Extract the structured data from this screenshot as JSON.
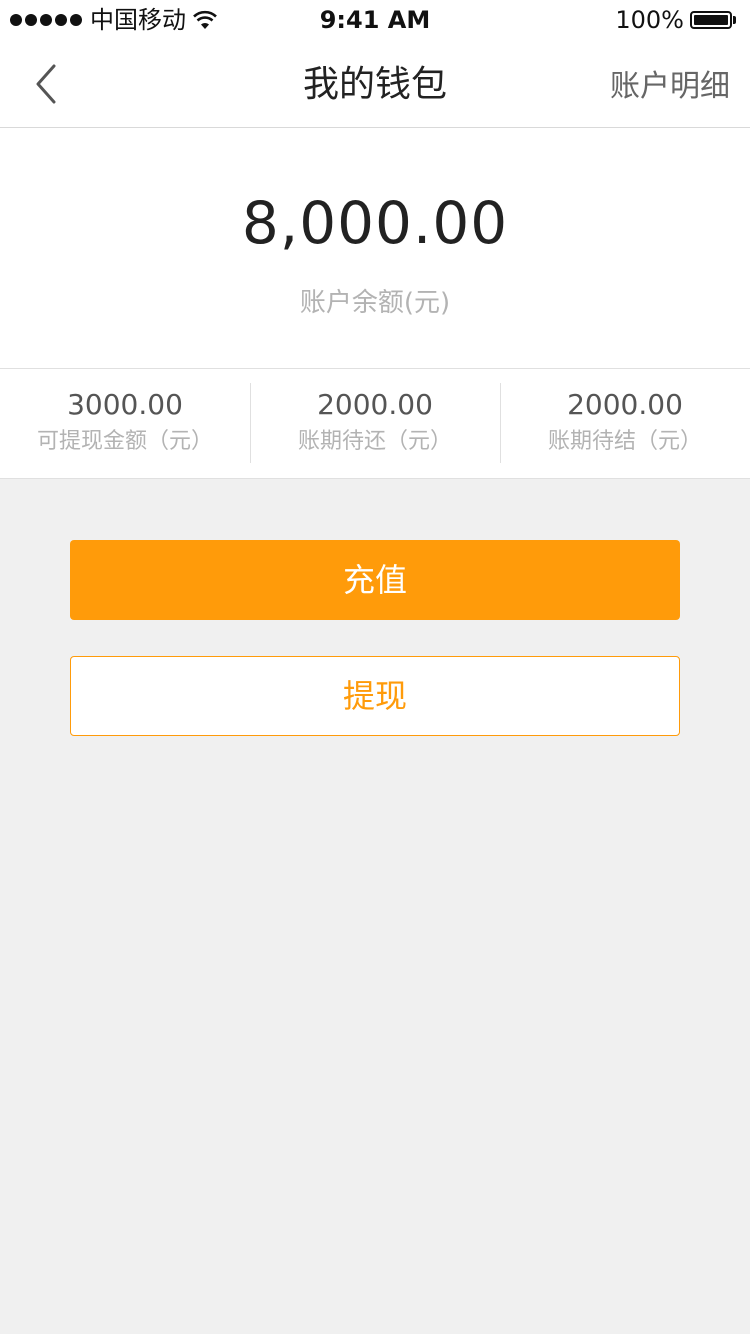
{
  "status_bar": {
    "carrier": "中国移动",
    "time": "9:41 AM",
    "battery": "100%"
  },
  "nav": {
    "title": "我的钱包",
    "right_link": "账户明细"
  },
  "balance": {
    "amount": "8,000.00",
    "label": "账户余额(元)"
  },
  "stats": [
    {
      "value": "3000.00",
      "label": "可提现金额（元）"
    },
    {
      "value": "2000.00",
      "label": "账期待还（元）"
    },
    {
      "value": "2000.00",
      "label": "账期待结（元）"
    }
  ],
  "buttons": {
    "recharge": "充值",
    "withdraw": "提现"
  },
  "colors": {
    "accent": "#ff9b0a",
    "background": "#f0f0f0"
  },
  "icons": {
    "back": "chevron-left-icon",
    "wifi": "wifi-icon",
    "battery": "battery-icon",
    "signal": "signal-dots-icon"
  }
}
